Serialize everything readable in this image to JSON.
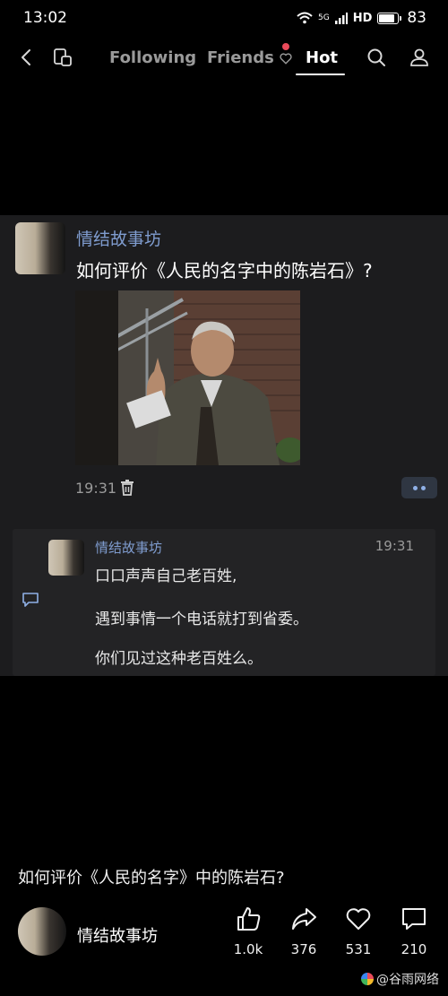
{
  "status": {
    "time": "13:02",
    "network": "5G",
    "hd": "HD",
    "battery": "83"
  },
  "nav": {
    "tabs": [
      "Following",
      "Friends",
      "Hot"
    ],
    "active": "Hot"
  },
  "post": {
    "author": "情结故事坊",
    "question": "如何评价《人民的名字中的陈岩石》?",
    "time": "19:31"
  },
  "comment": {
    "author": "情结故事坊",
    "time": "19:31",
    "lines": [
      "口口声声自己老百姓,",
      "遇到事情一个电话就打到省委。",
      "你们见过这种老百姓么。"
    ]
  },
  "feed": {
    "title": "如何评价《人民的名字》中的陈岩石?",
    "author": "情结故事坊",
    "likes": "1.0k",
    "shares": "376",
    "favorites": "531",
    "comments": "210"
  },
  "watermark": "@谷雨网络",
  "colors": {
    "background": "#000000",
    "card": "#1c1c1e",
    "link": "#7f9ccf",
    "badge": "#e94a5a"
  }
}
